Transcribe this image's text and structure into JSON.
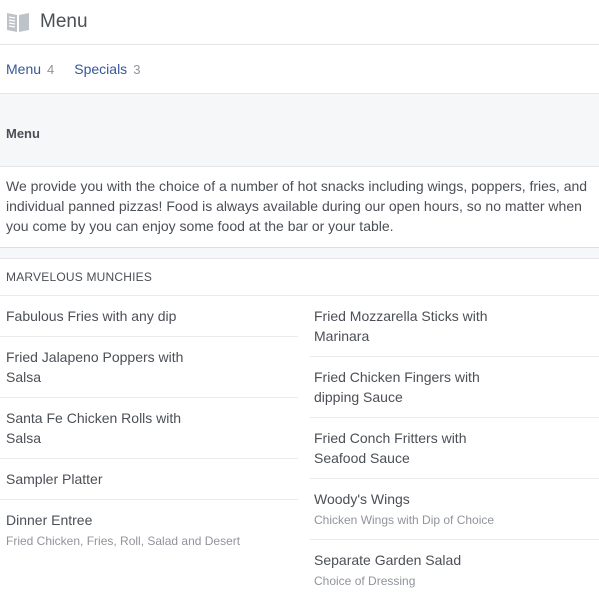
{
  "header": {
    "title": "Menu",
    "icon": "book-icon"
  },
  "tabs": [
    {
      "label": "Menu",
      "count": "4"
    },
    {
      "label": "Specials",
      "count": "3"
    }
  ],
  "section": {
    "heading": "Menu",
    "description": "We provide you with the choice of a number of hot snacks including wings, poppers, fries, and individual panned pizzas! Food is always available during our open hours, so no matter when you come by you can enjoy some food at the bar or your table."
  },
  "category": {
    "title": "MARVELOUS MUNCHIES"
  },
  "items_left": [
    {
      "name": "Fabulous Fries with any dip",
      "sub": ""
    },
    {
      "name": "Fried Jalapeno Poppers with Salsa",
      "sub": ""
    },
    {
      "name": "Santa Fe Chicken Rolls with Salsa",
      "sub": ""
    },
    {
      "name": "Sampler Platter",
      "sub": ""
    },
    {
      "name": "Dinner Entree",
      "sub": "Fried Chicken, Fries, Roll, Salad and Desert"
    }
  ],
  "items_right": [
    {
      "name": "Fried Mozzarella Sticks with Marinara",
      "sub": ""
    },
    {
      "name": "Fried Chicken Fingers with dipping Sauce",
      "sub": ""
    },
    {
      "name": "Fried Conch Fritters with Seafood Sauce",
      "sub": ""
    },
    {
      "name": "Woody's Wings",
      "sub": "Chicken Wings with Dip of Choice"
    },
    {
      "name": "Separate Garden Salad",
      "sub": "Choice of Dressing"
    }
  ]
}
